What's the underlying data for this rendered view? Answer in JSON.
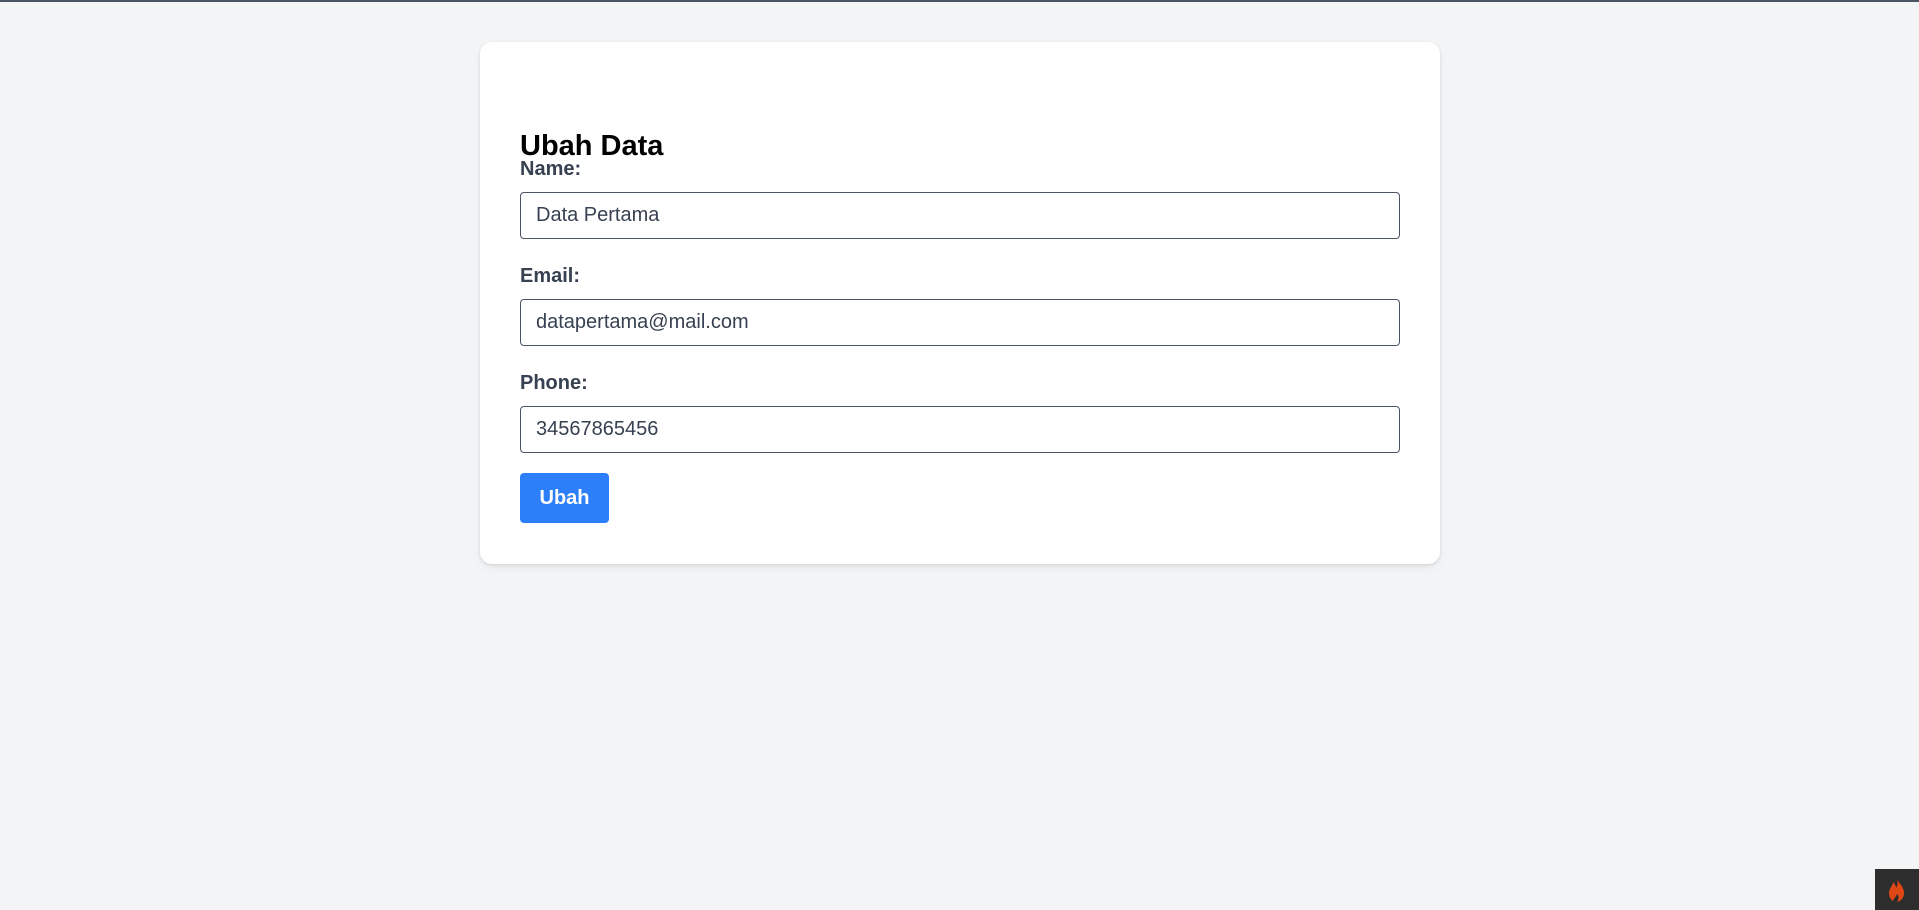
{
  "form": {
    "title": "Ubah Data",
    "name_label": "Name:",
    "name_value": "Data Pertama",
    "email_label": "Email:",
    "email_value": "datapertama@mail.com",
    "phone_label": "Phone:",
    "phone_value": "34567865456",
    "submit_label": "Ubah"
  },
  "toolbar": {
    "icon": "codeigniter-flame-icon"
  },
  "colors": {
    "background": "#f3f4f6",
    "card": "#ffffff",
    "button": "#2d7ff9",
    "label": "#374151",
    "flame": "#dd4814"
  }
}
